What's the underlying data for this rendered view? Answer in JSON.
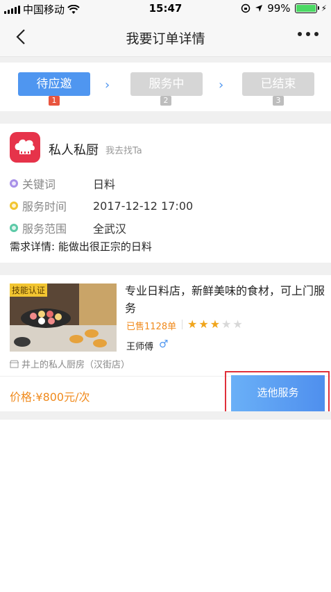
{
  "status_bar": {
    "carrier": "中国移动",
    "time": "15:47",
    "battery": "99%"
  },
  "nav": {
    "title": "我要订单详情"
  },
  "steps": [
    {
      "label": "待应邀",
      "num": "1",
      "active": true
    },
    {
      "label": "服务中",
      "num": "2",
      "active": false
    },
    {
      "label": "已结束",
      "num": "3",
      "active": false
    }
  ],
  "demand": {
    "app_name": "私人私厨",
    "find_link": "我去找Ta",
    "rows": [
      {
        "label": "关键词",
        "value": "日料",
        "color": "#a890e8"
      },
      {
        "label": "服务时间",
        "value": "2017-12-12 17:00",
        "color": "#f2c531"
      },
      {
        "label": "服务范围",
        "value": "全武汉",
        "color": "#5cc9a7"
      }
    ],
    "detail": "需求详情: 能做出很正宗的日料"
  },
  "service": {
    "skill_badge": "技能认证",
    "title": "专业日料店，新鲜美味的食材，可上门服务",
    "sold": "已售1128单",
    "rating": 3,
    "rating_max": 5,
    "master": "王师傅",
    "gender_icon": "male-icon",
    "shop": "井上的私人厨房（汉街店）",
    "price": "价格:¥800元/次",
    "choose_button": "选他服务"
  },
  "colors": {
    "accent": "#4f96f0",
    "orange": "#f08a1c",
    "highlight_border": "#e0303a"
  }
}
